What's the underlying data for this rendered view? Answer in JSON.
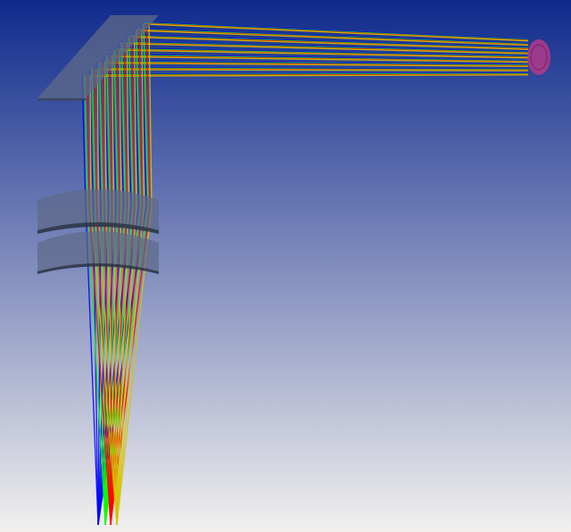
{
  "viewport": {
    "background_top": "#0f2a8c",
    "background_bottom": "#f2f0ee"
  },
  "elements": {
    "fold_mirror": {
      "color": "#5e6a88"
    },
    "lens_elements": {
      "color": "#5e6a88",
      "count": 2
    },
    "source_aperture": {
      "color": "#b23a8a"
    }
  },
  "rays": {
    "wavelength_colors": [
      "#0000ff",
      "#00ff00",
      "#ff0000",
      "#d4c400"
    ]
  }
}
